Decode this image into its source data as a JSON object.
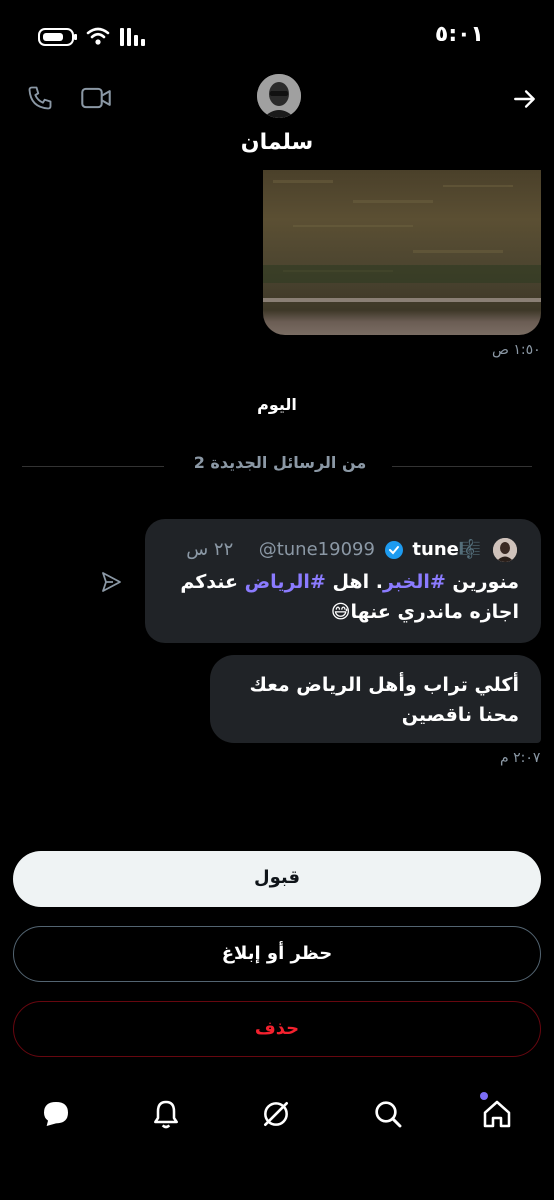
{
  "status_bar": {
    "time": "٥:٠١"
  },
  "header": {
    "contact_name": "سلمان",
    "icons": [
      "phone-icon",
      "video-icon",
      "back-arrow-icon"
    ]
  },
  "messages": {
    "image_time": "١:٥٠ ص",
    "day_label": "اليوم",
    "new_messages_label": "2 من الرسائل الجديدة",
    "tweet": {
      "display_name": "tune🎼",
      "handle": "@tune19099",
      "age": "٢٢ س",
      "text_1": "منورين ",
      "hashtag_1": "#الخبر",
      "text_2": ". اهل ",
      "hashtag_2": "#الرياض",
      "text_3": " عندكم اجازه  ماندري عنها😅"
    },
    "reply": {
      "text": "أكلي تراب وأهل الرياض معك محنا ناقصين",
      "time": "٢:٠٧ م"
    }
  },
  "actions": {
    "accept": "قبول",
    "block_report": "حظر أو إبلاغ",
    "delete": "حذف"
  },
  "bottom_nav": {
    "items": [
      "messages-icon",
      "notifications-icon",
      "grok-icon",
      "search-icon",
      "home-icon"
    ]
  },
  "colors": {
    "accent": "#7b6cf6",
    "hashtag": "#8b7bff",
    "delete": "#f4212e",
    "verified": "#1d9bf0"
  }
}
